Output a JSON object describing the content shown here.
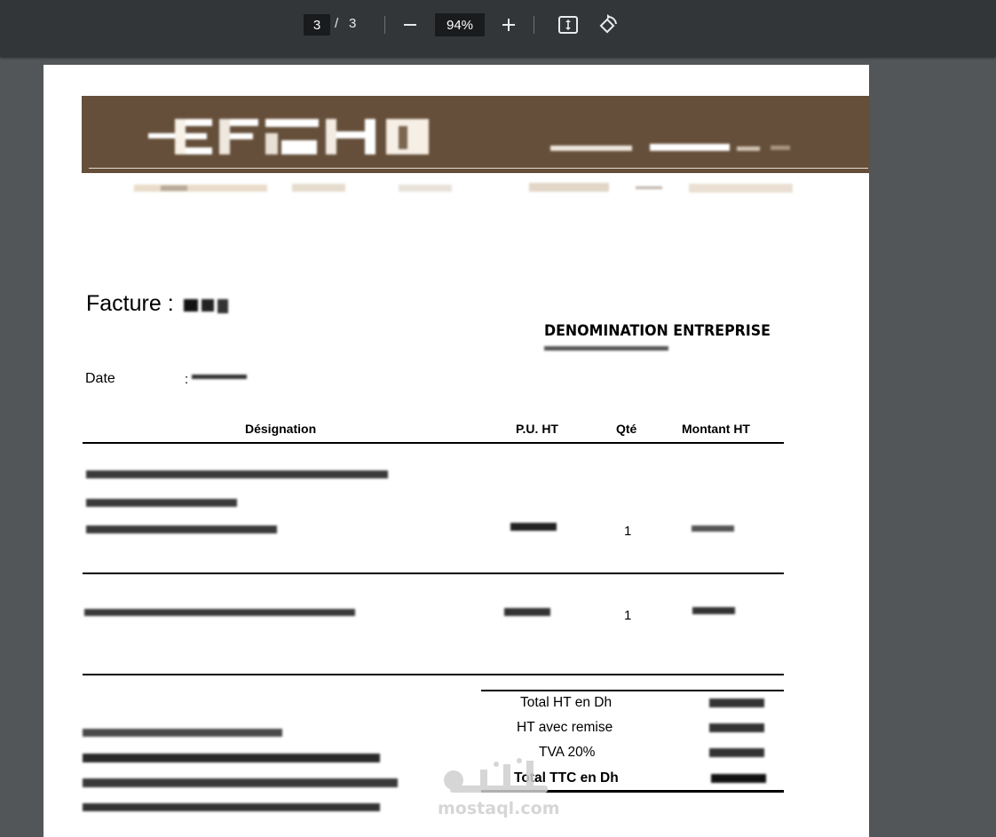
{
  "toolbar": {
    "current_page": "3",
    "page_separator": "/",
    "total_pages": "3",
    "zoom_out_symbol": "−",
    "zoom_level": "94%",
    "zoom_in_symbol": "+",
    "icons": [
      "zoom-out-icon",
      "zoom-in-icon",
      "fit-to-page-icon",
      "rotate-icon"
    ]
  },
  "invoice": {
    "title": "Facture :",
    "company_name": "DENOMINATION ENTREPRISE",
    "date_label": "Date",
    "date_colon": ":",
    "table_headers": {
      "designation": "Désignation",
      "unit_price": "P.U. HT",
      "quantity": "Qté",
      "amount": "Montant  HT"
    },
    "rows": [
      {
        "quantity": "1"
      },
      {
        "quantity": "1"
      }
    ],
    "totals": {
      "total_ht": "Total HT en Dh",
      "ht_remise": "HT avec remise",
      "tva": "TVA 20%",
      "total_ttc": "Total TTC en Dh"
    }
  },
  "colors": {
    "toolbar_bg": "#323639",
    "viewer_bg": "#525659",
    "banner_bg": "#654f3a",
    "page_bg": "#ffffff"
  }
}
